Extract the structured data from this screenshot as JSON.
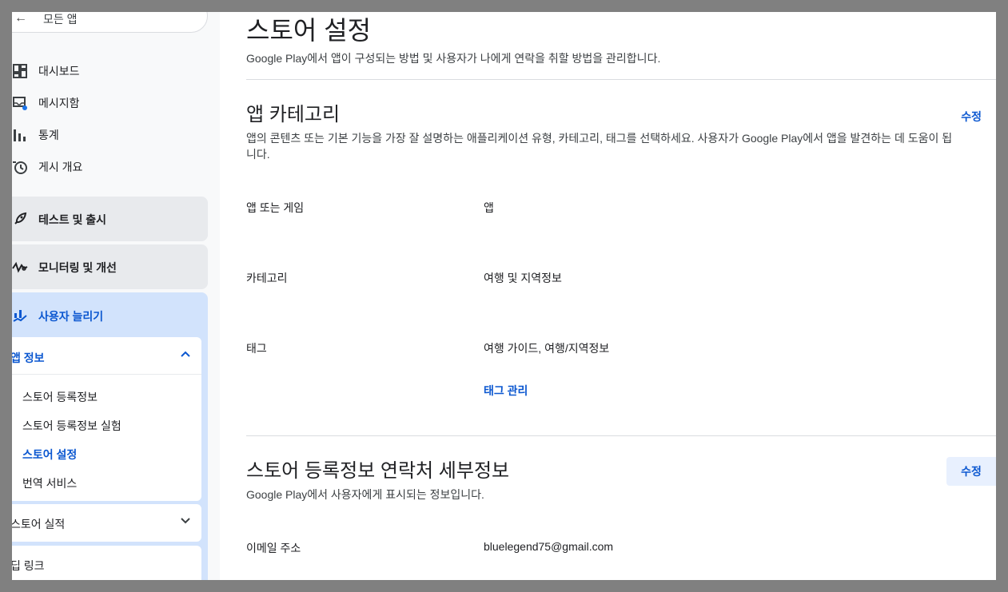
{
  "sidebar": {
    "back_label": "모든 앱",
    "nav": [
      {
        "label": "대시보드",
        "icon": "dashboard-icon"
      },
      {
        "label": "메시지함",
        "icon": "inbox-icon"
      },
      {
        "label": "통계",
        "icon": "bar-chart-icon"
      },
      {
        "label": "게시 개요",
        "icon": "history-icon"
      }
    ],
    "groups": {
      "test_release": "테스트 및 출시",
      "monitor": "모니터링 및 개선",
      "grow": "사용자 늘리기"
    },
    "app_info": {
      "header": "앱 정보",
      "items": [
        "스토어 등록정보",
        "스토어 등록정보 실험",
        "스토어 설정",
        "번역 서비스"
      ],
      "active_index": 2
    },
    "store_performance": "스토어 실적",
    "deep_links": "딥 링크"
  },
  "main": {
    "title": "스토어 설정",
    "subtitle": "Google Play에서 앱이 구성되는 방법 및 사용자가 나에게 연락을 취할 방법을 관리합니다.",
    "category_section": {
      "title": "앱 카테고리",
      "edit": "수정",
      "desc": "앱의 콘텐츠 또는 기본 기능을 가장 잘 설명하는 애플리케이션 유형, 카테고리, 태그를 선택하세요. 사용자가 Google Play에서 앱을 발견하는 데 도움이 됩니다.",
      "rows": [
        {
          "label": "앱 또는 게임",
          "value": "앱"
        },
        {
          "label": "카테고리",
          "value": "여행 및 지역정보"
        },
        {
          "label": "태그",
          "value": "여행 가이드, 여행/지역정보"
        }
      ],
      "manage_tags": "태그 관리"
    },
    "contact_section": {
      "title": "스토어 등록정보 연락처 세부정보",
      "edit": "수정",
      "desc": "Google Play에서 사용자에게 표시되는 정보입니다.",
      "rows": [
        {
          "label": "이메일 주소",
          "value": "bluelegend75@gmail.com"
        }
      ]
    }
  },
  "colors": {
    "accent": "#0b57d0",
    "selected_bg": "#d2e3fc",
    "group_bg": "#e8eaed",
    "backdrop": "#808080"
  }
}
